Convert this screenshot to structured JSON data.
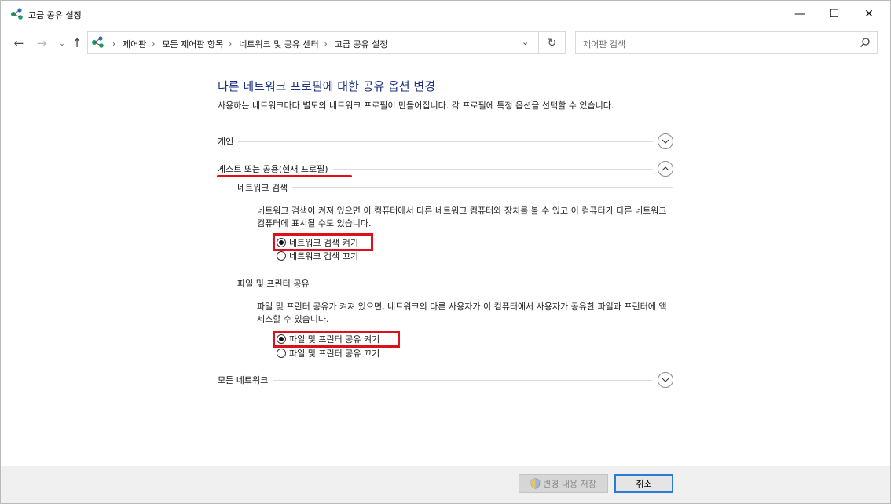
{
  "window": {
    "title": "고급 공유 설정",
    "min_glyph": "—",
    "max_glyph": "☐",
    "close_glyph": "✕"
  },
  "nav": {
    "back_glyph": "←",
    "forward_glyph": "→",
    "recent_glyph": "⌄",
    "up_glyph": "↑",
    "refresh_glyph": "↻",
    "dropdown_glyph": "⌄"
  },
  "breadcrumb": {
    "items": [
      "제어판",
      "모든 제어판 항목",
      "네트워크 및 공유 센터",
      "고급 공유 설정"
    ],
    "separator": "›"
  },
  "search": {
    "placeholder": "제어판 검색"
  },
  "main": {
    "heading": "다른 네트워크 프로필에 대한 공유 옵션 변경",
    "intro": "사용하는 네트워크마다 별도의 네트워크 프로필이 만들어집니다. 각 프로필에 특정 옵션을 선택할 수 있습니다."
  },
  "profiles": [
    {
      "label": "개인",
      "expanded": false
    },
    {
      "label": "게스트 또는 공용(현재 프로필)",
      "expanded": true
    },
    {
      "label": "모든 네트워크",
      "expanded": false
    }
  ],
  "network_discovery": {
    "label": "네트워크 검색",
    "description": "네트워크 검색이 켜져 있으면 이 컴퓨터에서 다른 네트워크 컴퓨터와 장치를 볼 수 있고 이 컴퓨터가 다른 네트워크 컴퓨터에 표시될 수도 있습니다.",
    "options": [
      {
        "label": "네트워크 검색 켜기",
        "checked": true
      },
      {
        "label": "네트워크 검색 끄기",
        "checked": false
      }
    ]
  },
  "file_sharing": {
    "label": "파일 및 프린터 공유",
    "description": "파일 및 프린터 공유가 켜져 있으면, 네트워크의 다른 사용자가 이 컴퓨터에서 사용자가 공유한 파일과 프린터에 액세스할 수 있습니다.",
    "options": [
      {
        "label": "파일 및 프린터 공유 켜기",
        "checked": true
      },
      {
        "label": "파일 및 프린터 공유 끄기",
        "checked": false
      }
    ]
  },
  "footer": {
    "save_label": "변경 내용 저장",
    "save_enabled": false,
    "cancel_label": "취소"
  },
  "colors": {
    "heading": "#1e3287",
    "highlight": "#e0101a",
    "focus_border": "#2a7ad6",
    "network_icon": "#1aa260"
  },
  "icons": {
    "window_icon": "network-sharing-icon",
    "shield": "uac-shield-icon"
  }
}
